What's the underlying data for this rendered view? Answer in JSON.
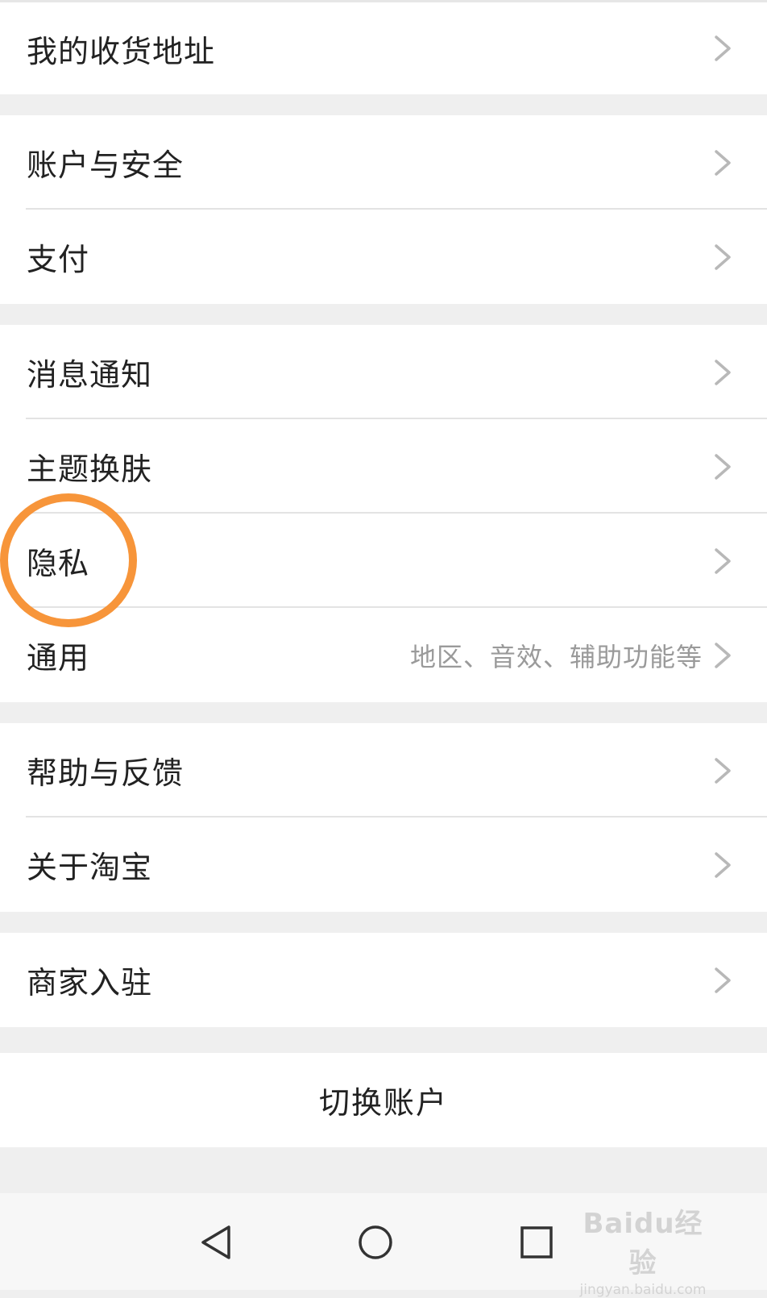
{
  "groups": [
    {
      "items": [
        {
          "label": "我的收货地址"
        }
      ]
    },
    {
      "items": [
        {
          "label": "账户与安全"
        },
        {
          "label": "支付"
        }
      ]
    },
    {
      "items": [
        {
          "label": "消息通知"
        },
        {
          "label": "主题换肤"
        },
        {
          "label": "隐私"
        },
        {
          "label": "通用",
          "hint": "地区、音效、辅助功能等"
        }
      ]
    },
    {
      "items": [
        {
          "label": "帮助与反馈"
        },
        {
          "label": "关于淘宝"
        }
      ]
    },
    {
      "items": [
        {
          "label": "商家入驻"
        }
      ]
    }
  ],
  "switch_account": {
    "label": "切换账户"
  },
  "watermark": {
    "brand": "Baidu经验",
    "url": "jingyan.baidu.com"
  },
  "icons": {
    "chevron": "chevron-right-icon",
    "nav_back": "triangle-back-icon",
    "nav_home": "circle-home-icon",
    "nav_recent": "square-recents-icon"
  },
  "colors": {
    "highlight": "#f7953a",
    "background": "#efefef",
    "divider": "#e3e3e3"
  }
}
